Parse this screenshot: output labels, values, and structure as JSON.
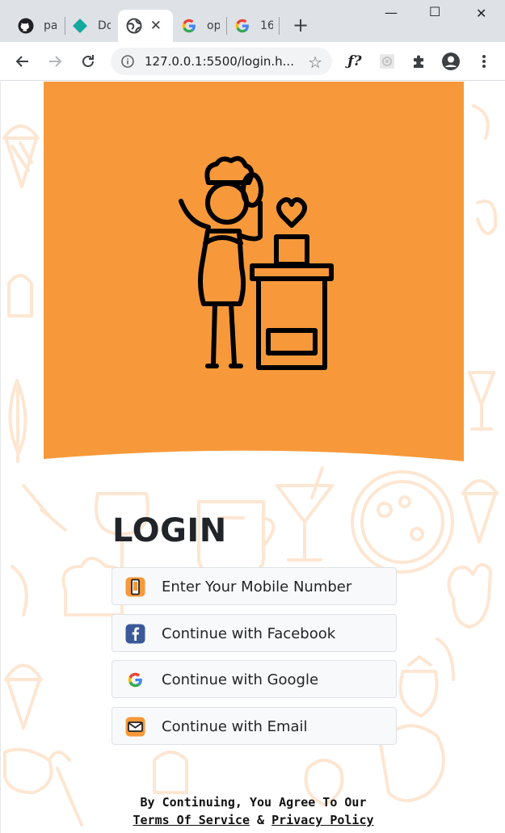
{
  "browser": {
    "tabs": [
      {
        "label": "pa",
        "icon": "github-icon"
      },
      {
        "label": "Do",
        "icon": "diamond-icon"
      },
      {
        "label": "",
        "icon": "globe-icon",
        "active": true
      },
      {
        "label": "op",
        "icon": "google-icon"
      },
      {
        "label": "16",
        "icon": "google-icon"
      }
    ],
    "new_tab": "+",
    "window_controls": {
      "minimize": "—",
      "maximize": "☐",
      "close": "✕"
    },
    "url": "127.0.0.1:5500/login.h...",
    "extensions": [
      "font-finder-icon",
      "extension-gear-icon",
      "puzzle-icon",
      "profile-icon",
      "menu-icon"
    ]
  },
  "hero": {
    "background": "#f7993a",
    "illustration": "chef-cooking-icon"
  },
  "login": {
    "title": "LOGIN",
    "buttons": [
      {
        "label": "Enter Your Mobile Number",
        "icon": "mobile-phone-icon"
      },
      {
        "label": "Continue with Facebook",
        "icon": "facebook-icon"
      },
      {
        "label": "Continue with Google",
        "icon": "google-icon"
      },
      {
        "label": "Continue with Email",
        "icon": "email-icon"
      }
    ]
  },
  "footer": {
    "line1": "By Continuing, You Agree To Our",
    "terms": "Terms Of Service",
    "amp": "&",
    "privacy": "Privacy Policy"
  },
  "colors": {
    "accent": "#f7993a",
    "doodle": "#fde6d2",
    "facebook": "#3b5998"
  }
}
